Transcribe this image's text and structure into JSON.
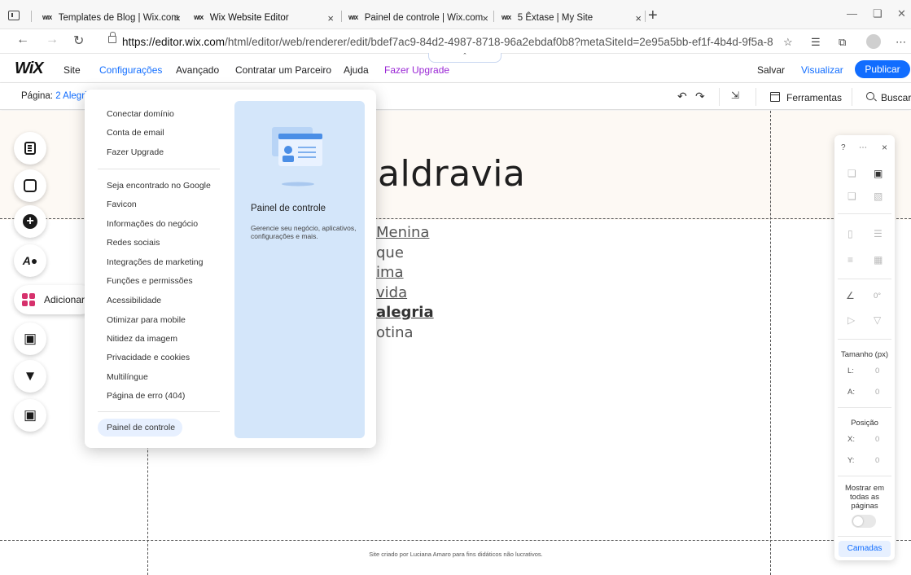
{
  "browser": {
    "tabs": [
      {
        "favicon": "WIX",
        "title": "Templates de Blog | Wix.com"
      },
      {
        "favicon": "WIX",
        "title": "Wix Website Editor"
      },
      {
        "favicon": "WIX",
        "title": "Painel de controle | Wix.com"
      },
      {
        "favicon": "WIX",
        "title": "5 Êxtase | My Site"
      }
    ],
    "url_domain": "https://editor.wix.com",
    "url_path": "/html/editor/web/renderer/edit/bdef7ac9-84d2-4987-8718-96a2ebdaf0b8?metaSiteId=2e95a5bb-ef1f-4b4d-9f5a-81c51...",
    "new_tab_glyph": "+",
    "close_glyph": "×"
  },
  "editor": {
    "logo": "WiX",
    "menu": {
      "site": "Site",
      "settings": "Configurações",
      "advanced": "Avançado",
      "hire": "Contratar um Parceiro",
      "help": "Ajuda",
      "upgrade": "Fazer Upgrade"
    },
    "save": "Salvar",
    "preview": "Visualizar",
    "publish": "Publicar",
    "page_label": "Página:",
    "page_value": "2 Alegria",
    "tools": "Ferramentas",
    "search": "Buscar"
  },
  "settings_menu": {
    "group1": [
      "Conectar domínio",
      "Conta de email",
      "Fazer Upgrade"
    ],
    "group2": [
      "Seja encontrado no Google",
      "Favicon",
      "Informações do negócio",
      "Redes sociais",
      "Integrações de marketing",
      "Funções e permissões",
      "Acessibilidade",
      "Otimizar para mobile",
      "Nitidez da imagem",
      "Privacidade e cookies",
      "Multilíngue",
      "Página de erro (404)"
    ],
    "dashboard_button": "Painel de controle",
    "card_title": "Painel de controle",
    "card_desc": "Gerencie seu negócio, aplicativos, configurações e mais."
  },
  "left_toolbar": {
    "add_label": "Adicionar"
  },
  "site": {
    "title": "aldravia",
    "menu": [
      "Menina",
      "que",
      "ima",
      "vida",
      "alegria",
      "otina"
    ],
    "footer": "Site criado por Luciana Amaro para fins didáticos não lucrativos."
  },
  "inspector": {
    "help": "?",
    "close": "×",
    "size_label": "Tamanho (px)",
    "width_label": "L:",
    "width_value": "0",
    "height_label": "A:",
    "height_value": "0",
    "position_label": "Posição",
    "x_label": "X:",
    "x_value": "0",
    "y_label": "Y:",
    "y_value": "0",
    "rotation_value": "0°",
    "show_all": "Mostrar em todas as páginas",
    "layers": "Camadas"
  },
  "colors": {
    "accent": "#116dff",
    "upgrade": "#9a27d5",
    "card": "#d4e6fa",
    "add_icon": "#d6316c"
  }
}
